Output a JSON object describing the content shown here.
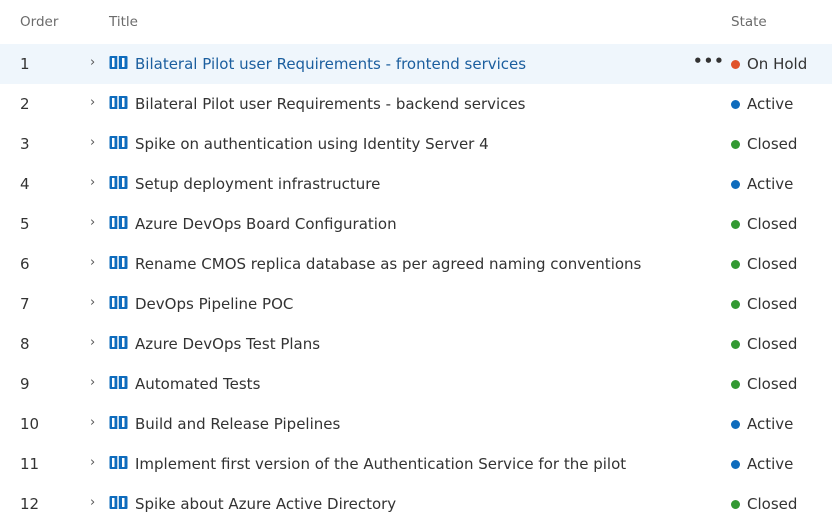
{
  "columns": {
    "order": "Order",
    "title": "Title",
    "state": "State"
  },
  "state_colors": {
    "On Hold": "#e0532a",
    "Active": "#0f6cbd",
    "Closed": "#339933"
  },
  "icon_color": "#0f6cbd",
  "more_actions_label": "•••",
  "chevron_glyph": "›",
  "rows": [
    {
      "order": "1",
      "title": "Bilateral Pilot user Requirements - frontend services",
      "state": "On Hold"
    },
    {
      "order": "2",
      "title": "Bilateral Pilot user Requirements - backend services",
      "state": "Active"
    },
    {
      "order": "3",
      "title": "Spike on authentication using Identity Server 4",
      "state": "Closed"
    },
    {
      "order": "4",
      "title": "Setup deployment infrastructure",
      "state": "Active"
    },
    {
      "order": "5",
      "title": "Azure DevOps Board Configuration",
      "state": "Closed"
    },
    {
      "order": "6",
      "title": "Rename CMOS replica database as per agreed naming conventions",
      "state": "Closed"
    },
    {
      "order": "7",
      "title": "DevOps Pipeline POC",
      "state": "Closed"
    },
    {
      "order": "8",
      "title": "Azure DevOps Test Plans",
      "state": "Closed"
    },
    {
      "order": "9",
      "title": "Automated Tests",
      "state": "Closed"
    },
    {
      "order": "10",
      "title": "Build and Release Pipelines",
      "state": "Active"
    },
    {
      "order": "11",
      "title": "Implement first version of the Authentication Service for the pilot",
      "state": "Active"
    },
    {
      "order": "12",
      "title": "Spike about Azure Active Directory",
      "state": "Closed"
    }
  ]
}
